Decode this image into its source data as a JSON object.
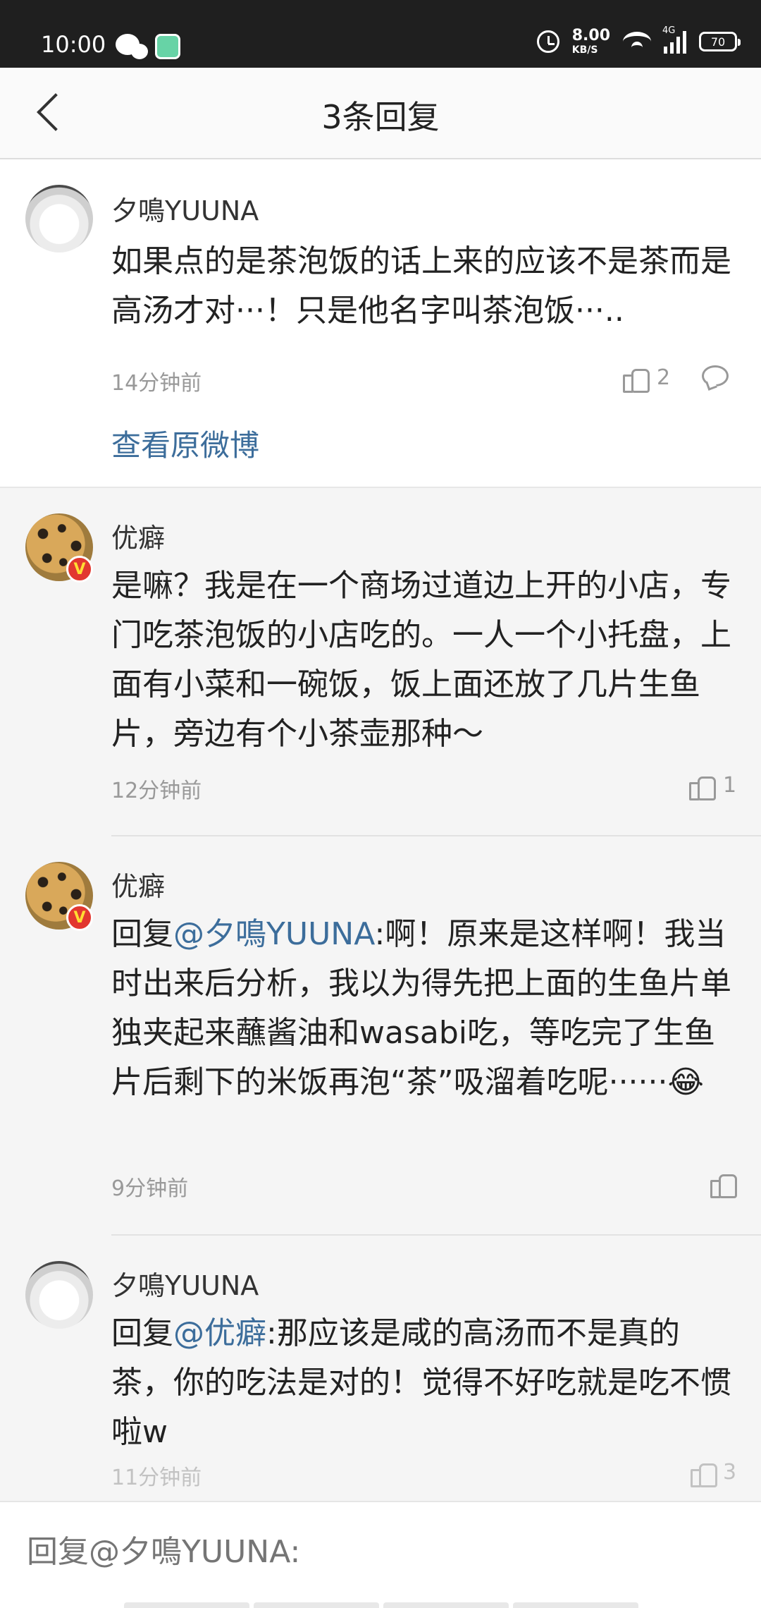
{
  "status": {
    "time": "10:00",
    "speed_value": "8.00",
    "speed_unit": "KB/S",
    "network": "4G",
    "battery": "70"
  },
  "header": {
    "title": "3条回复"
  },
  "root_comment": {
    "username": "夕鳴YUUNA",
    "text": "如果点的是茶泡饭的话上来的应该不是茶而是高汤才对···！只是他名字叫茶泡饭···..",
    "time": "14分钟前",
    "likes": "2",
    "view_original": "查看原微博"
  },
  "replies": [
    {
      "username": "优癖",
      "text": "是嘛？我是在一个商场过道边上开的小店，专门吃茶泡饭的小店吃的。一人一个小托盘，上面有小菜和一碗饭，饭上面还放了几片生鱼片，旁边有个小茶壶那种～",
      "time": "12分钟前",
      "likes": "1"
    },
    {
      "username": "优癖",
      "reply_prefix": "回复",
      "mention": "@夕鳴YUUNA",
      "text": ":啊！原来是这样啊！我当时出来后分析，我以为得先把上面的生鱼片单独夹起来蘸酱油和wasabi吃，等吃完了生鱼片后剩下的米饭再泡“茶”吸溜着吃呢······😂",
      "time": "9分钟前",
      "likes": ""
    },
    {
      "username": "夕鳴YUUNA",
      "reply_prefix": "回复",
      "mention": "@优癖",
      "text": ":那应该是咸的高汤而不是真的茶，你的吃法是对的！觉得不好吃就是吃不惯啦w",
      "time": "11分钟前",
      "likes": "3"
    }
  ],
  "composer": {
    "placeholder": "回复@夕鳴YUUNA:"
  },
  "colors": {
    "link": "#3c6d9b",
    "verified_badge": "#e2372f"
  },
  "icons": {
    "like": "thumbs-up-icon",
    "comment": "comment-bubble-icon",
    "back": "back-arrow-icon"
  }
}
